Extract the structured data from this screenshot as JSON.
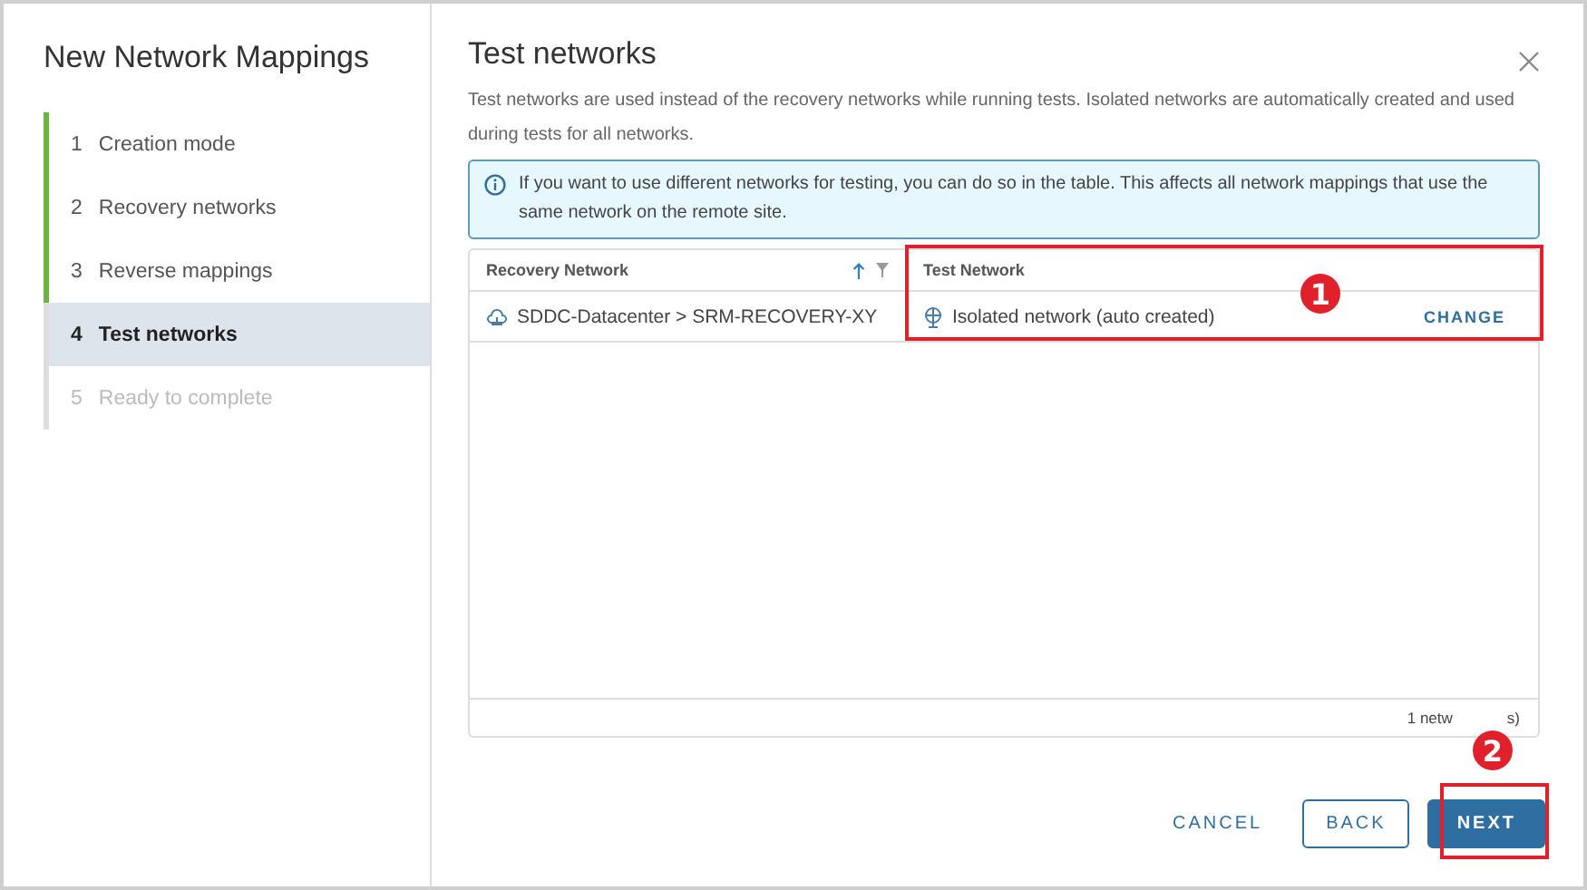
{
  "wizard": {
    "title": "New Network Mappings"
  },
  "steps": [
    {
      "number": "1",
      "label": "Creation mode",
      "done": true,
      "disabled": false,
      "selected": false
    },
    {
      "number": "2",
      "label": "Recovery networks",
      "done": true,
      "disabled": false,
      "selected": false
    },
    {
      "number": "3",
      "label": "Reverse mappings",
      "done": true,
      "disabled": false,
      "selected": false
    },
    {
      "number": "4",
      "label": "Test networks",
      "done": false,
      "disabled": false,
      "selected": true
    },
    {
      "number": "5",
      "label": "Ready to complete",
      "done": false,
      "disabled": true,
      "selected": false
    }
  ],
  "page": {
    "title": "Test networks",
    "description": "Test networks are used instead of the recovery networks while running tests. Isolated networks are automatically created and used during tests for all networks."
  },
  "info_banner": "If you want to use different networks for testing, you can do so in the table. This affects all network mappings that use the same network on the remote site.",
  "table": {
    "columns": [
      {
        "label": "Recovery Network"
      },
      {
        "label": "Test Network"
      }
    ],
    "rows": [
      {
        "recovery_network": "SDDC-Datacenter > SRM-RECOVERY-XY",
        "test_network": "Isolated network (auto created)",
        "action": "CHANGE"
      }
    ],
    "footer": [
      "1 netw",
      "s)"
    ]
  },
  "buttons": [
    {
      "label": "CANCEL",
      "kind": "flat"
    },
    {
      "label": "BACK",
      "kind": "outline"
    },
    {
      "label": "NEXT",
      "kind": "primary"
    }
  ],
  "annotations": [
    {
      "label": "1"
    },
    {
      "label": "2"
    }
  ]
}
